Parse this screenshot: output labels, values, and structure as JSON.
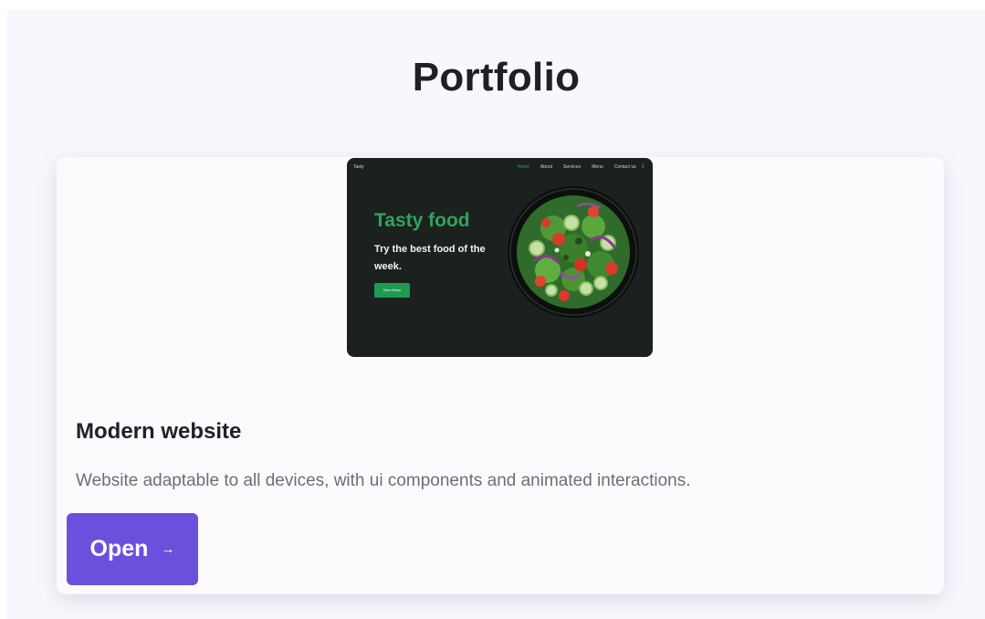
{
  "page": {
    "title": "Portfolio"
  },
  "project": {
    "title": "Modern website",
    "description": "Website adaptable to all devices, with ui components and animated interactions.",
    "open_label": "Open",
    "open_icon": "arrow-right-icon"
  },
  "preview": {
    "logo": "Tasty",
    "nav": [
      "Home",
      "About",
      "Services",
      "Menu",
      "Contact us"
    ],
    "nav_icon": "moon-icon",
    "headline": "Tasty food",
    "subheadline": "Try the best food of the week.",
    "button_label": "View Menu"
  },
  "colors": {
    "accent": "#6b4fdd",
    "preview_green": "#2fa55c",
    "preview_bg": "#1a211f"
  }
}
